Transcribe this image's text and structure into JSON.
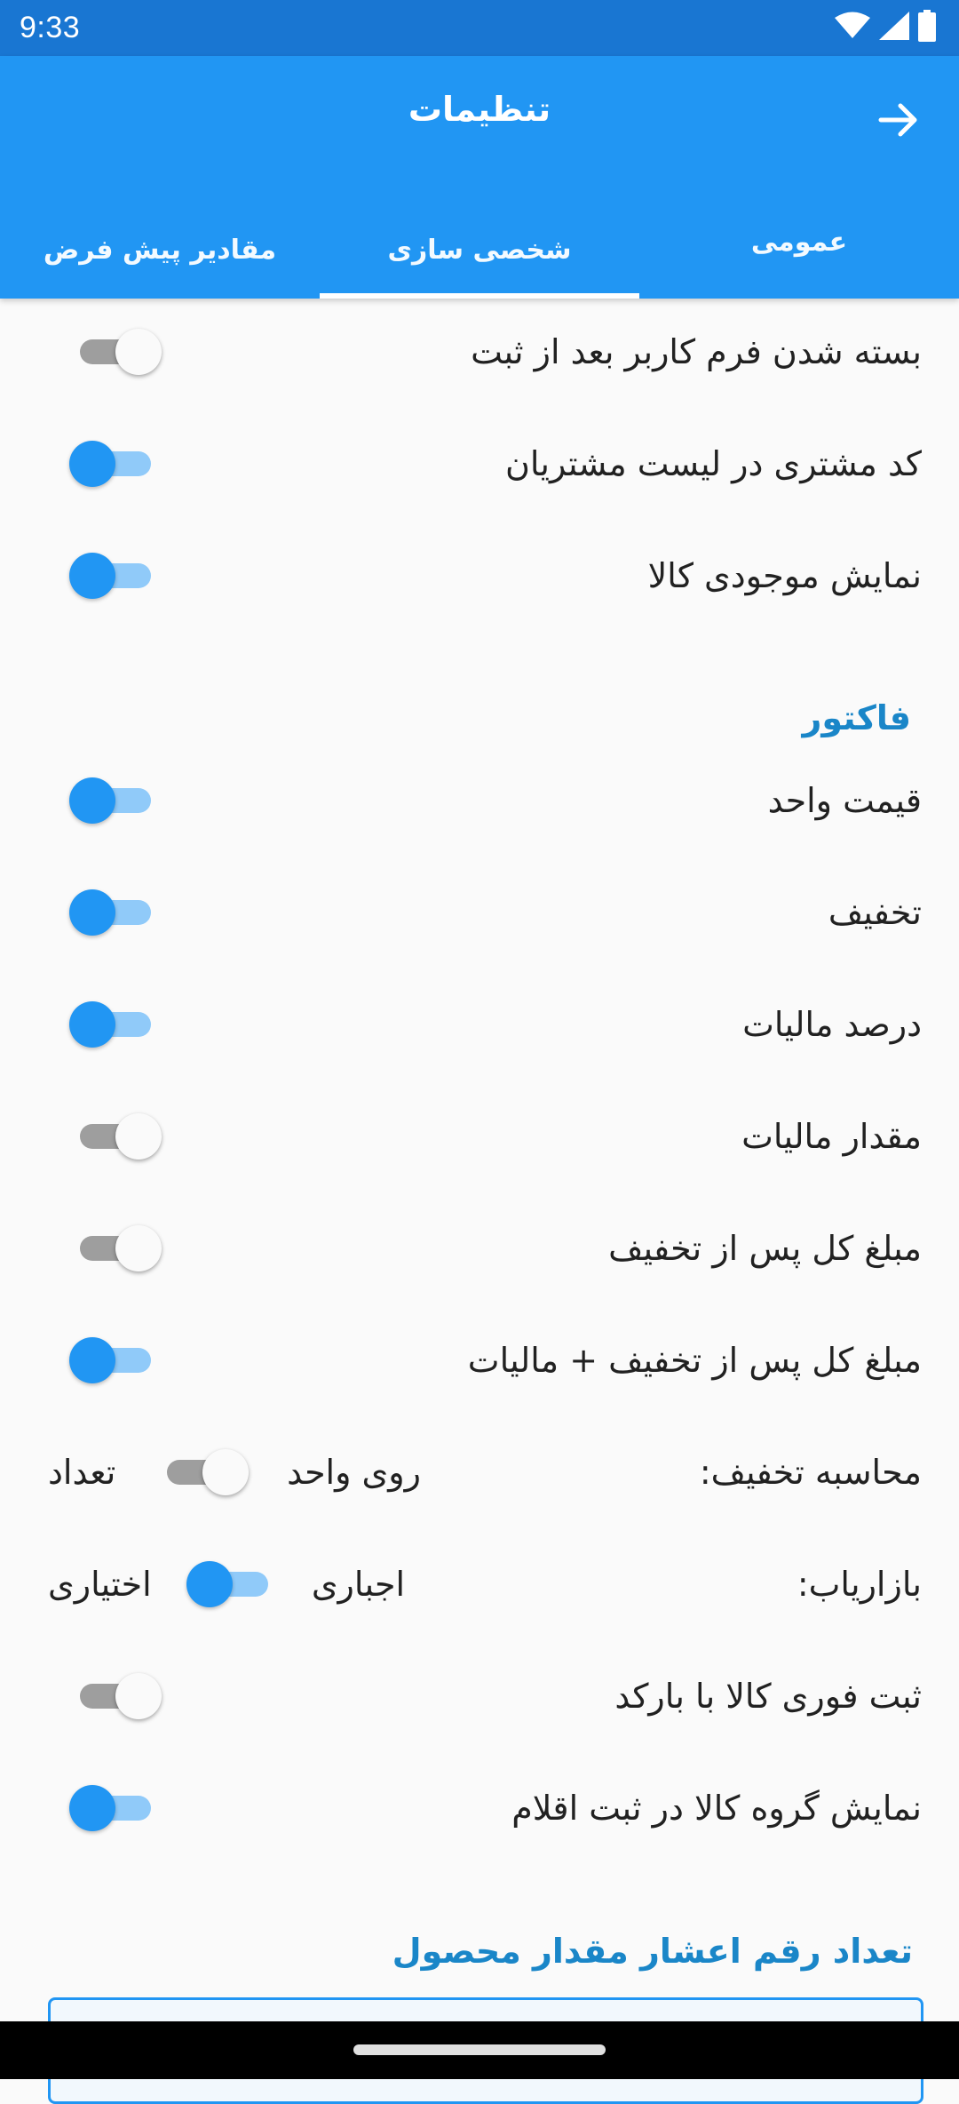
{
  "status_bar": {
    "time": "9:33",
    "icons": [
      "wifi-icon",
      "signal-icon",
      "battery-icon"
    ]
  },
  "app_bar": {
    "title": "تنظیمات",
    "back_icon": "arrow-right-icon"
  },
  "tabs": [
    {
      "label": "مقادیر پیش فرض",
      "active": false
    },
    {
      "label": "شخصی سازی",
      "active": true
    },
    {
      "label": "عمومی",
      "active": false
    }
  ],
  "general_toggles": [
    {
      "label": "بسته شدن فرم کاربر بعد از ثبت",
      "on": false
    },
    {
      "label": "کد مشتری در لیست مشتریان",
      "on": true
    },
    {
      "label": "نمایش موجودی کالا",
      "on": true
    }
  ],
  "invoice_section": {
    "title": "فاکتور",
    "toggles": [
      {
        "label": "قیمت واحد",
        "on": true
      },
      {
        "label": "تخفیف",
        "on": true
      },
      {
        "label": "درصد مالیات",
        "on": true
      },
      {
        "label": "مقدار مالیات",
        "on": false
      },
      {
        "label": "مبلغ کل پس از تخفیف",
        "on": false
      },
      {
        "label": "مبلغ کل پس از تخفیف + مالیات",
        "on": true
      }
    ],
    "discount_calc": {
      "label": "محاسبه تخفیف:",
      "option_right": "روی واحد",
      "option_left": "تعداد",
      "on": false
    },
    "marketer": {
      "label": "بازاریاب:",
      "option_right": "اجباری",
      "option_left": "اختیاری",
      "on": true
    },
    "more_toggles": [
      {
        "label": "ثبت فوری کالا با بارکد",
        "on": false
      },
      {
        "label": "نمایش گروه کالا در ثبت اقلام",
        "on": true
      }
    ]
  },
  "decimal_section": {
    "title": "تعداد رقم اعشار مقدار محصول"
  },
  "colors": {
    "status_bar": "#1976d2",
    "app_bar": "#2196f3",
    "accent": "#2196f3",
    "section_header": "#1a86c8"
  }
}
